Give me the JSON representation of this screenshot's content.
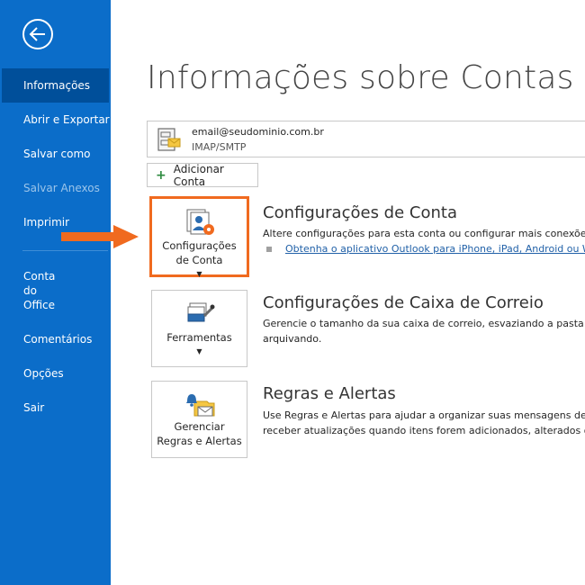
{
  "sidebar": {
    "items": [
      {
        "label": "Informações"
      },
      {
        "label": "Abrir e Exportar"
      },
      {
        "label": "Salvar como"
      },
      {
        "label": "Salvar Anexos"
      },
      {
        "label": "Imprimir"
      },
      {
        "lines": [
          "Conta",
          "do",
          "Office"
        ]
      },
      {
        "label": "Comentários"
      },
      {
        "label": "Opções"
      },
      {
        "label": "Sair"
      }
    ]
  },
  "main": {
    "title": "Informações sobre Contas",
    "account": {
      "email": "email@seudominio.com.br",
      "type": "IMAP/SMTP"
    },
    "add_account": "Adicionar Conta",
    "sections": [
      {
        "button_lines": [
          "Configurações",
          "de Conta"
        ],
        "title": "Configurações de Conta",
        "desc": [
          "Altere configurações para esta conta ou configurar mais conexões."
        ],
        "link": "Obtenha o aplicativo Outlook para iPhone, iPad, Android ou Wi"
      },
      {
        "button_lines": [
          "Ferramentas"
        ],
        "title": "Configurações de Caixa de Correio",
        "desc": [
          "Gerencie o tamanho da sua caixa de correio, esvaziando a pasta Itens",
          "arquivando."
        ]
      },
      {
        "button_lines": [
          "Gerenciar",
          "Regras e Alertas"
        ],
        "title": "Regras e Alertas",
        "desc": [
          "Use Regras e Alertas para ajudar a organizar suas mensagens de ema",
          "receber atualizações quando itens forem adicionados, alterados ou r"
        ]
      }
    ]
  },
  "colors": {
    "sidebar": "#0b6dc9",
    "sidebar_active": "#004f9a",
    "highlight": "#f06a1f",
    "link": "#2161a8"
  }
}
